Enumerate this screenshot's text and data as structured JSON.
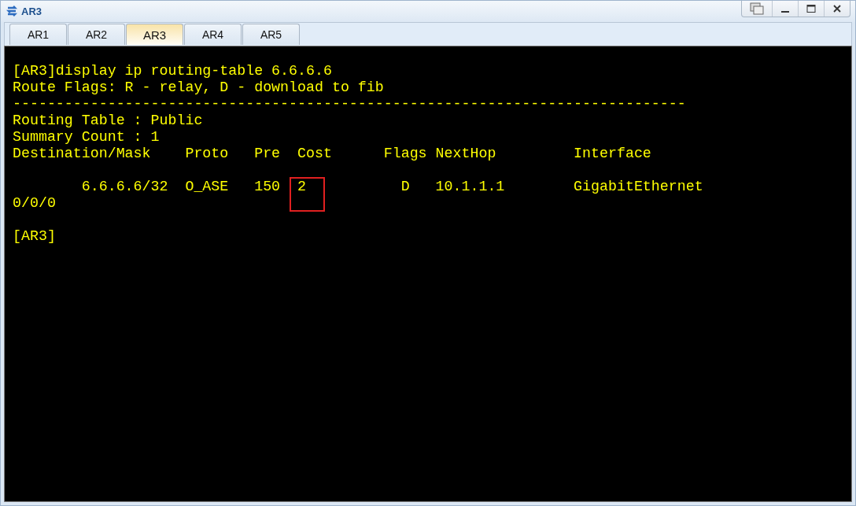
{
  "window": {
    "title": "AR3"
  },
  "tabs": [
    {
      "label": "AR1",
      "selected": false
    },
    {
      "label": "AR2",
      "selected": false
    },
    {
      "label": "AR3",
      "selected": true
    },
    {
      "label": "AR4",
      "selected": false
    },
    {
      "label": "AR5",
      "selected": false
    }
  ],
  "terminal": {
    "lines": [
      {
        "kind": "text",
        "text": "[AR3]display ip routing-table 6.6.6.6"
      },
      {
        "kind": "text",
        "text": "Route Flags: R - relay, D - download to fib"
      },
      {
        "kind": "text",
        "text": "------------------------------------------------------------------------------"
      },
      {
        "kind": "text",
        "text": "Routing Table : Public"
      },
      {
        "kind": "text",
        "text": "Summary Count : 1"
      },
      {
        "kind": "text",
        "text": "Destination/Mask    Proto   Pre  Cost      Flags NextHop         Interface"
      },
      {
        "kind": "blank"
      },
      {
        "kind": "highlight",
        "before": "        6.6.6.6/32  O_ASE   150  ",
        "highlighted": "2",
        "after": "           D   10.1.1.1        GigabitEthernet"
      },
      {
        "kind": "text",
        "text": "0/0/0"
      },
      {
        "kind": "blank"
      },
      {
        "kind": "text",
        "text": "[AR3]"
      }
    ]
  }
}
